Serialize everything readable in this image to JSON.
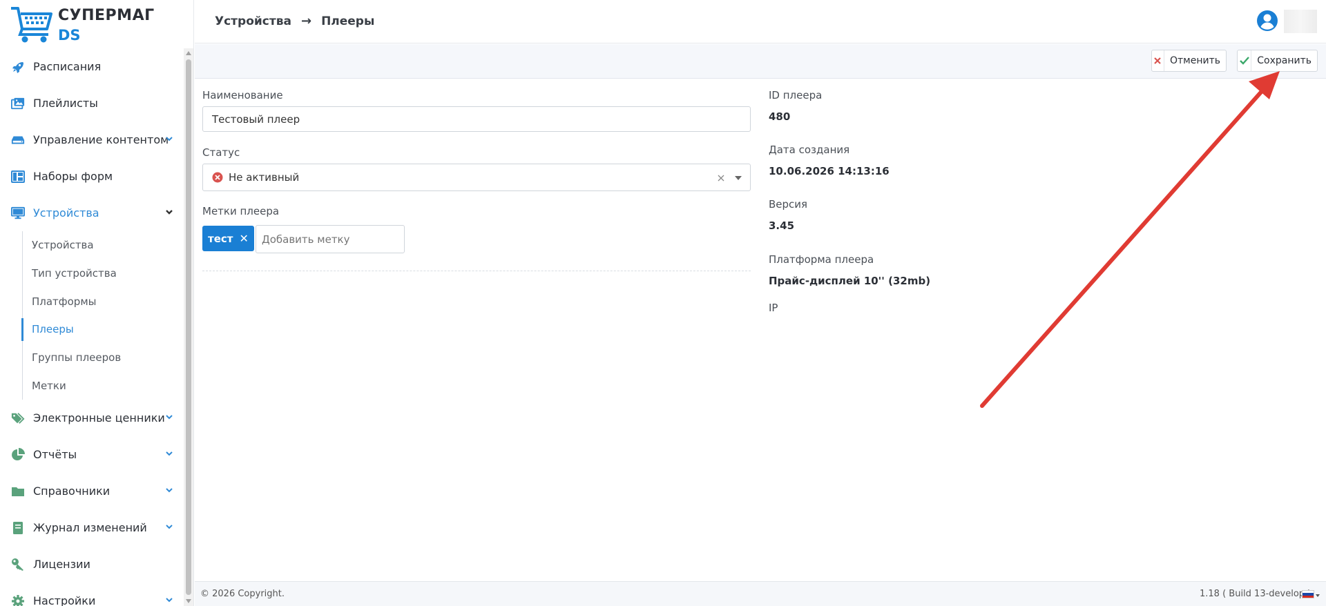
{
  "app": {
    "logo_title": "СУПЕРМАГ",
    "logo_subtitle": "DS",
    "brand_color": "#1a86d8",
    "accent_color": "#2f8ad6"
  },
  "sidebar": {
    "items": [
      {
        "label": "Расписания",
        "icon": "rocket-icon",
        "icon_color": "#2f8ad6"
      },
      {
        "label": "Плейлисты",
        "icon": "images-icon",
        "icon_color": "#2f8ad6"
      },
      {
        "label": "Управление контентом",
        "icon": "storage-icon",
        "icon_color": "#2f8ad6",
        "expandable": true
      },
      {
        "label": "Наборы форм",
        "icon": "layout-icon",
        "icon_color": "#2f8ad6"
      },
      {
        "label": "Устройства",
        "icon": "monitor-icon",
        "icon_color": "#2f8ad6",
        "expandable": true,
        "expanded": true,
        "active": true
      }
    ],
    "subitems": [
      {
        "label": "Устройства"
      },
      {
        "label": "Тип устройства"
      },
      {
        "label": "Платформы"
      },
      {
        "label": "Плееры",
        "active": true
      },
      {
        "label": "Группы плееров"
      },
      {
        "label": "Метки"
      }
    ],
    "items_after": [
      {
        "label": "Электронные ценники",
        "icon": "tags-icon",
        "icon_color": "#5aa27c",
        "expandable": true
      },
      {
        "label": "Отчёты",
        "icon": "pie-chart-icon",
        "icon_color": "#5aa27c",
        "expandable": true
      },
      {
        "label": "Справочники",
        "icon": "folder-icon",
        "icon_color": "#5aa27c",
        "expandable": true
      },
      {
        "label": "Журнал изменений",
        "icon": "book-icon",
        "icon_color": "#5aa27c",
        "expandable": true
      },
      {
        "label": "Лицензии",
        "icon": "key-icon",
        "icon_color": "#5aa27c"
      },
      {
        "label": "Настройки",
        "icon": "gear-icon",
        "icon_color": "#5aa27c",
        "expandable": true
      }
    ]
  },
  "header": {
    "breadcrumb_parent": "Устройства",
    "breadcrumb_arrow": "→",
    "breadcrumb_current": "Плееры"
  },
  "toolbar": {
    "cancel_label": "Отменить",
    "save_label": "Сохранить"
  },
  "form": {
    "name_label": "Наименование",
    "name_value": "Тестовый плеер",
    "status_label": "Статус",
    "status_value": "Не активный",
    "tags_label": "Метки плеера",
    "tags": [
      "тест"
    ],
    "tag_placeholder": "Добавить метку"
  },
  "info": {
    "id_label": "ID плеера",
    "id_value": "480",
    "created_label": "Дата создания",
    "created_value": "10.06.2026 14:13:16",
    "version_label": "Версия",
    "version_value": "3.45",
    "platform_label": "Платформа плеера",
    "platform_value": "Прайс-дисплей 10'' (32mb)",
    "ip_label": "IP"
  },
  "footer": {
    "copyright": "© 2026 Copyright.",
    "build": "1.18 ( Build 13-develop )"
  }
}
